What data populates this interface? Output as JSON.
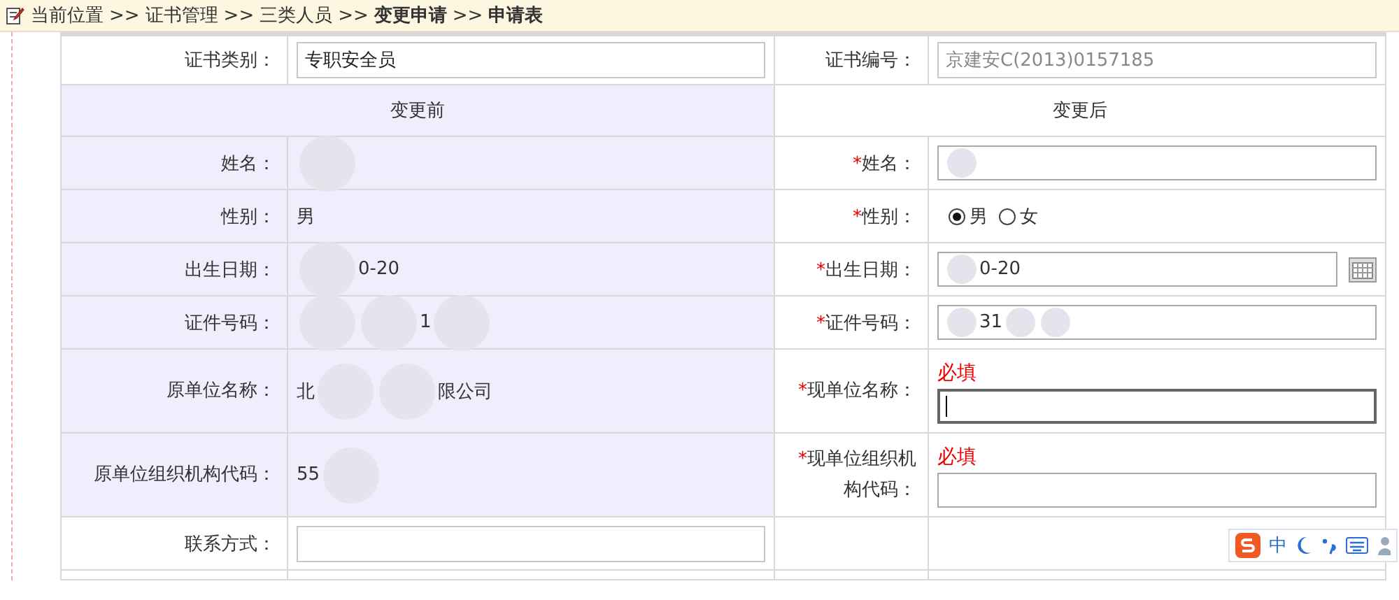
{
  "breadcrumb": [
    {
      "text": "当前位置",
      "bold": false
    },
    {
      "text": "证书管理",
      "bold": false
    },
    {
      "text": "三类人员",
      "bold": false
    },
    {
      "text": "变更申请",
      "bold": true
    },
    {
      "text": "申请表",
      "bold": true
    }
  ],
  "breadcrumb_separator": ">>",
  "required_mark": "*",
  "certificate": {
    "type_label": "证书类别：",
    "type_value": "专职安全员",
    "number_label": "证书编号：",
    "number_value": "京建安C(2013)0157185",
    "number_disabled": true
  },
  "headers": {
    "before": "变更前",
    "after": "变更后"
  },
  "rows": [
    {
      "before_label": "姓名：",
      "before_value": [
        {
          "kind": "blot"
        }
      ],
      "after_label": "姓名：",
      "required": true,
      "after": {
        "kind": "text",
        "value": [
          {
            "kind": "blot"
          }
        ]
      }
    },
    {
      "before_label": "性别：",
      "before_value": [
        {
          "kind": "text",
          "text": "男"
        }
      ],
      "after_label": "性别：",
      "required": true,
      "after": {
        "kind": "radio",
        "options": [
          {
            "label": "男",
            "selected": true
          },
          {
            "label": "女",
            "selected": false
          }
        ]
      }
    },
    {
      "before_label": "出生日期：",
      "before_value": [
        {
          "kind": "blot"
        },
        {
          "kind": "text",
          "text": "0-20"
        }
      ],
      "after_label": "出生日期：",
      "required": true,
      "after": {
        "kind": "date",
        "value": [
          {
            "kind": "blot"
          },
          {
            "kind": "text",
            "text": "0-20"
          }
        ]
      }
    },
    {
      "before_label": "证件号码：",
      "before_value": [
        {
          "kind": "blot"
        },
        {
          "kind": "blot"
        },
        {
          "kind": "text",
          "text": "1"
        },
        {
          "kind": "blot"
        }
      ],
      "after_label": "证件号码：",
      "required": true,
      "after": {
        "kind": "text",
        "value": [
          {
            "kind": "blot"
          },
          {
            "kind": "text",
            "text": "31"
          },
          {
            "kind": "blot"
          },
          {
            "kind": "blot"
          }
        ]
      }
    },
    {
      "before_label": "原单位名称：",
      "before_value": [
        {
          "kind": "text",
          "text": "北"
        },
        {
          "kind": "blot"
        },
        {
          "kind": "blot"
        },
        {
          "kind": "text",
          "text": "限公司"
        }
      ],
      "after_label": "现单位名称：",
      "required": true,
      "after": {
        "kind": "hinted",
        "hint": "必填",
        "focused": true
      }
    },
    {
      "before_label": "原单位组织机构代码：",
      "before_value": [
        {
          "kind": "text",
          "text": "55"
        },
        {
          "kind": "blot"
        }
      ],
      "after_label": "现单位组织机构代码：",
      "required": true,
      "after": {
        "kind": "hinted",
        "hint": "必填",
        "focused": false
      }
    }
  ],
  "contact": {
    "label": "联系方式："
  },
  "ime_toolbar": {
    "mode": "中"
  }
}
